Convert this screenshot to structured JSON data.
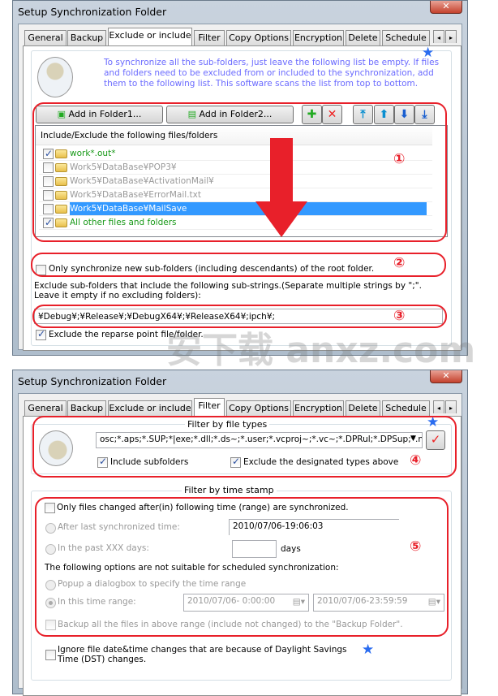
{
  "dialog1": {
    "title": "Setup Synchronization Folder",
    "close_label": "✕",
    "tabs": [
      "General",
      "Backup",
      "Exclude or include",
      "Filter",
      "Copy Options",
      "Encryption",
      "Delete",
      "Schedule"
    ],
    "active_tab": "Exclude or include",
    "info_text": "To synchronize all the sub-folders, just leave the following list be empty. If files and folders need to be excluded from or included to the synchronization, add them to the following list. This software scans the list from top to bottom.",
    "add_folder1": "Add in Folder1...",
    "add_folder2": "Add in Folder2...",
    "list_header": "Include/Exclude the following files/folders",
    "items": [
      {
        "label": "work*.out*",
        "checked": true,
        "state": "include"
      },
      {
        "label": "Work5¥DataBase¥POP3¥",
        "checked": false,
        "state": "disabled"
      },
      {
        "label": "Work5¥DataBase¥ActivationMail¥",
        "checked": false,
        "state": "disabled"
      },
      {
        "label": "Work5¥DataBase¥ErrorMail.txt",
        "checked": false,
        "state": "disabled"
      },
      {
        "label": "Work5¥DataBase¥MailSave",
        "checked": false,
        "state": "selected"
      },
      {
        "label": "All other files and folders",
        "checked": true,
        "state": "include"
      }
    ],
    "only_new_subfolders": "Only synchronize new sub-folders (including descendants) of the root folder.",
    "exclude_substrings_label": "Exclude sub-folders that include the following sub-strings.(Separate multiple strings by \";\". Leave it empty if no excluding folders):",
    "exclude_substrings_value": "¥Debug¥;¥Release¥;¥DebugX64¥;¥ReleaseX64¥;ipch¥;",
    "exclude_reparse": "Exclude the reparse point file/folder.",
    "markers": [
      "①",
      "②",
      "③"
    ]
  },
  "dialog2": {
    "title": "Setup Synchronization Folder",
    "close_label": "✕",
    "tabs": [
      "General",
      "Backup",
      "Exclude or include",
      "Filter",
      "Copy Options",
      "Encryption",
      "Delete",
      "Schedule"
    ],
    "active_tab": "Filter",
    "filter_types_title": "Filter by file types",
    "file_types_value": "osc;*.aps;*.SUP;*|exe;*.dll;*.ds~;*.user;*.vcproj~;*.vc~;*.DPRul;*.DPSup;*.map;",
    "include_subfolders": "Include subfolders",
    "exclude_designated": "Exclude the designated types above",
    "timestamp_title": "Filter by time stamp",
    "only_changed": "Only files changed after(in) following time (range) are synchronized.",
    "after_last_sync": "After last synchronized time:",
    "last_sync_value": "2010/07/06-19:06:03",
    "past_days": "In the past XXX days:",
    "days_value": "",
    "days_unit": "days",
    "not_suitable": "The following options are not suitable for scheduled synchronization:",
    "popup_dialog": "Popup a dialogbox to specify the time range",
    "in_range": "In this time range:",
    "range_start": "2010/07/06-  0:00:00",
    "range_end": "2010/07/06-23:59:59",
    "backup_all": "Backup all the files in above range (include not changed) to the \"Backup Folder\".",
    "ignore_dst": "Ignore file date&time changes that are because of Daylight Savings Time (DST) changes.",
    "markers": [
      "④",
      "⑤"
    ]
  },
  "watermark": "安下载 anxz.com",
  "colors": {
    "annotation_red": "#e8202a",
    "info_text": "#6b6bff",
    "include_green": "#1a9a1a",
    "selection": "#3399ff"
  }
}
